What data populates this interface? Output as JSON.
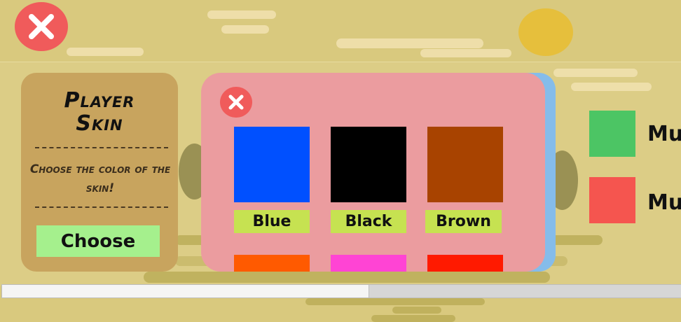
{
  "colors": {
    "sky": "#d9c97e",
    "card": "#c8a45e",
    "modal": "#eb9c9f",
    "close": "#f05b5b",
    "choose_button": "#a5f08d",
    "label_bg": "#c6e251"
  },
  "player_skin_panel": {
    "title_line1": "Player",
    "title_line2": "Skin",
    "description": "Choose the color of the skin!",
    "choose_label": "Choose"
  },
  "color_picker": {
    "close_icon": "close-icon",
    "options": [
      {
        "name": "Blue",
        "color": "#0050ff"
      },
      {
        "name": "Black",
        "color": "#000000"
      },
      {
        "name": "Brown",
        "color": "#a84300"
      }
    ],
    "next_row_colors": [
      "#ff5a00",
      "#ff44d4",
      "#ff1a00"
    ]
  },
  "side_options": [
    {
      "color": "#4cc564",
      "label": "Mu"
    },
    {
      "color": "#f5554f",
      "label": "Mu"
    }
  ],
  "progress": {
    "fraction": 0.54
  }
}
